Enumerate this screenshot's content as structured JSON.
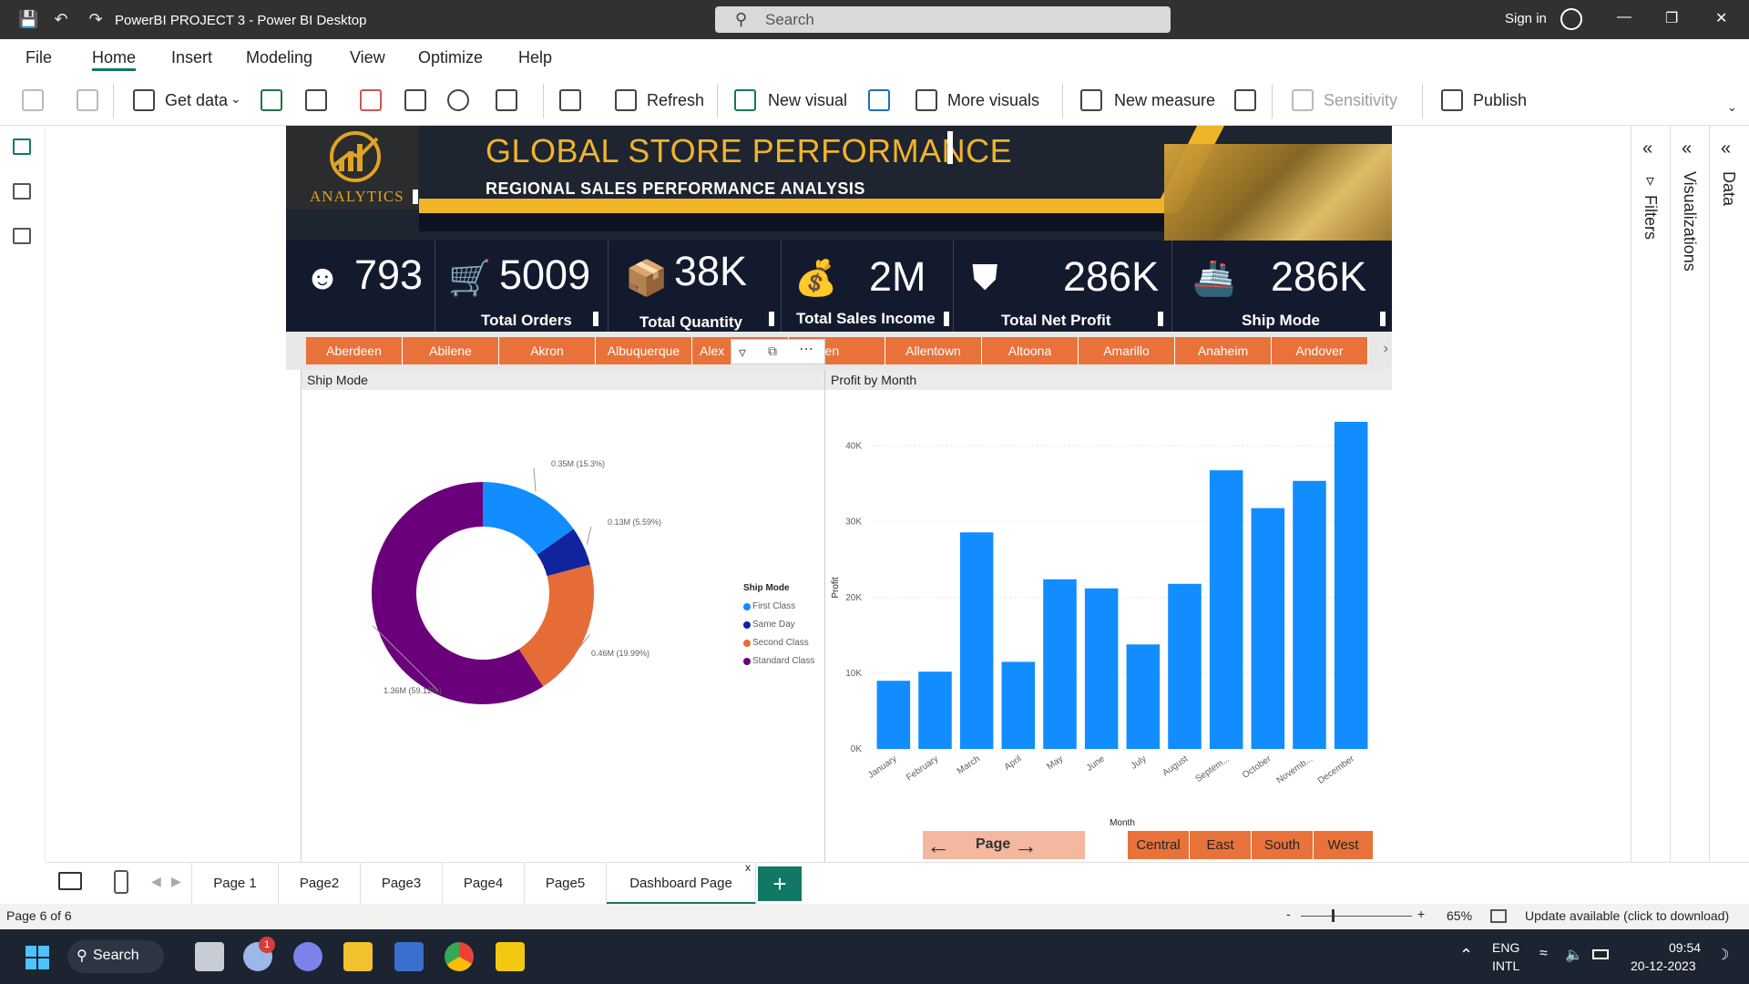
{
  "window": {
    "title": "PowerBI PROJECT 3 - Power BI Desktop",
    "search_placeholder": "Search",
    "sign_in": "Sign in"
  },
  "menu": [
    "File",
    "Home",
    "Insert",
    "Modeling",
    "View",
    "Optimize",
    "Help"
  ],
  "ribbon": {
    "get_data": "Get data",
    "refresh": "Refresh",
    "new_visual": "New visual",
    "more_visuals": "More visuals",
    "new_measure": "New measure",
    "sensitivity": "Sensitivity",
    "publish": "Publish"
  },
  "report": {
    "logo_text": "ANALYTICS",
    "title": "GLOBAL STORE PERFORMANCE",
    "subtitle": "REGIONAL SALES PERFORMANCE ANALYSIS",
    "kpis": [
      {
        "icon": "user-icon",
        "value": "793",
        "label": ""
      },
      {
        "icon": "cart-icon",
        "value": "5009",
        "label": "Total Orders"
      },
      {
        "icon": "box-icon",
        "value": "38K",
        "label": "Total Quantity"
      },
      {
        "icon": "money-icon",
        "value": "2M",
        "label": "Total Sales Income"
      },
      {
        "icon": "coins-icon",
        "value": "286K",
        "label": "Total Net Profit"
      },
      {
        "icon": "ship-icon",
        "value": "286K",
        "label": "Ship Mode"
      }
    ],
    "cities": [
      "Aberdeen",
      "Abilene",
      "Akron",
      "Albuquerque",
      "Alex",
      "Allen",
      "Allentown",
      "Altoona",
      "Amarillo",
      "Anaheim",
      "Andover"
    ],
    "ship_panel_title": "Ship Mode",
    "profit_panel_title": "Profit by Month",
    "page_nav_label": "Page",
    "regions": [
      "Central",
      "East",
      "South",
      "West"
    ]
  },
  "chart_data": [
    {
      "type": "pie",
      "title": "Ship Mode",
      "legend_title": "Ship Mode",
      "legend_position": "right",
      "slices": [
        {
          "name": "First Class",
          "value": 0.35,
          "label": "0.35M (15.3%)",
          "color": "#118dff"
        },
        {
          "name": "Same Day",
          "value": 0.13,
          "label": "0.13M (5.59%)",
          "color": "#12239e"
        },
        {
          "name": "Second Class",
          "value": 0.46,
          "label": "0.46M (19.99%)",
          "color": "#e66c37"
        },
        {
          "name": "Standard Class",
          "value": 1.36,
          "label": "1.36M (59.12%)",
          "color": "#6b007b"
        }
      ]
    },
    {
      "type": "bar",
      "title": "Profit by Month",
      "xlabel": "Month",
      "ylabel": "Profit",
      "ylim": [
        0,
        45000
      ],
      "yticks": [
        "0K",
        "10K",
        "20K",
        "30K",
        "40K"
      ],
      "categories": [
        "January",
        "February",
        "March",
        "April",
        "May",
        "June",
        "July",
        "August",
        "Septem...",
        "October",
        "Novemb...",
        "December"
      ],
      "values": [
        9000,
        10200,
        28600,
        11500,
        22400,
        21200,
        13800,
        21800,
        36800,
        31800,
        35400,
        43200
      ],
      "color": "#118dff"
    }
  ],
  "page_tabs": [
    "Page 1",
    "Page2",
    "Page3",
    "Page4",
    "Page5",
    "Dashboard Page"
  ],
  "status": {
    "page": "Page 6 of 6",
    "zoom": "65%",
    "update": "Update available (click to download)"
  },
  "taskbar": {
    "search": "Search",
    "lang1": "ENG",
    "lang2": "INTL",
    "time": "09:54",
    "date": "20-12-2023",
    "badge": "1"
  }
}
